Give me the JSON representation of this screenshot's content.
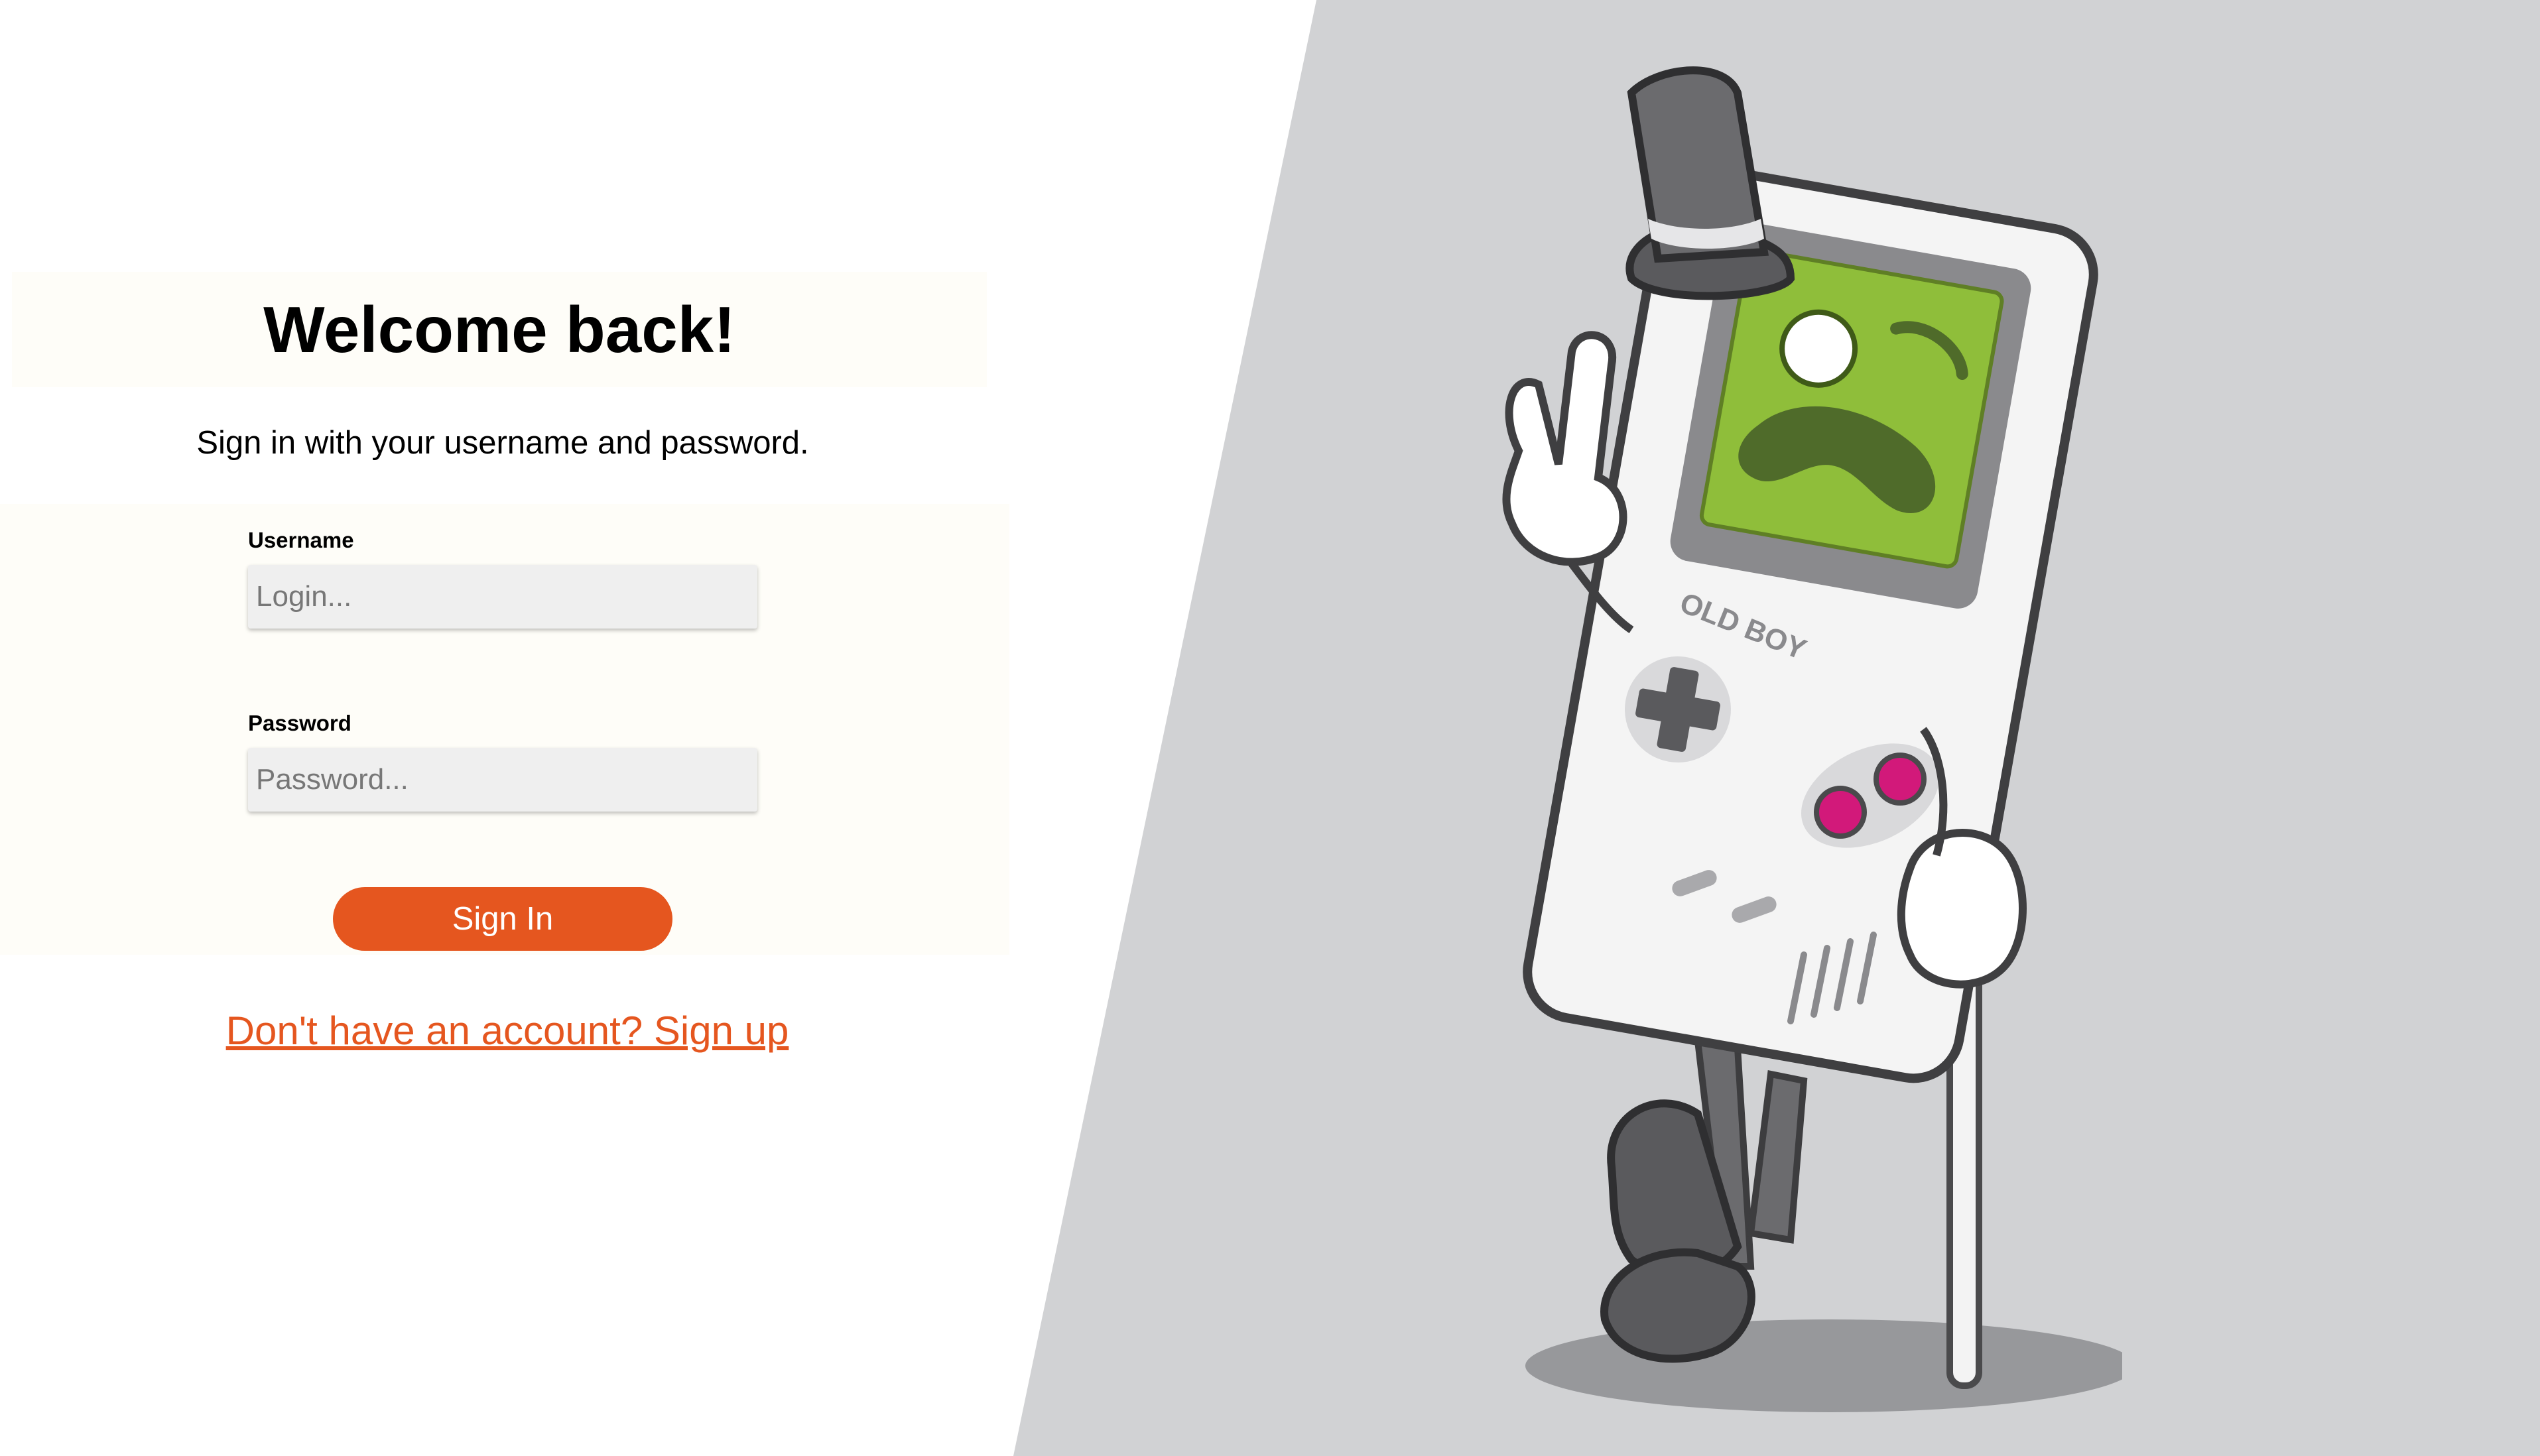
{
  "header": {
    "title": "Welcome back!",
    "subtitle": "Sign in with your username and password."
  },
  "form": {
    "username_label": "Username",
    "username_placeholder": "Login...",
    "username_value": "",
    "password_label": "Password",
    "password_placeholder": "Password...",
    "password_value": "",
    "submit_label": "Sign In"
  },
  "signup": {
    "link_text": "Don't have an account? Sign up"
  },
  "illustration": {
    "name": "old-boy-gameboy-mascot",
    "device_text": "OLD BOY"
  },
  "colors": {
    "accent": "#e5561f",
    "panel_grey": "#d1d2d4",
    "form_bg": "#fefdf8",
    "input_bg": "#efefef",
    "screen_green": "#8fbe3a"
  }
}
